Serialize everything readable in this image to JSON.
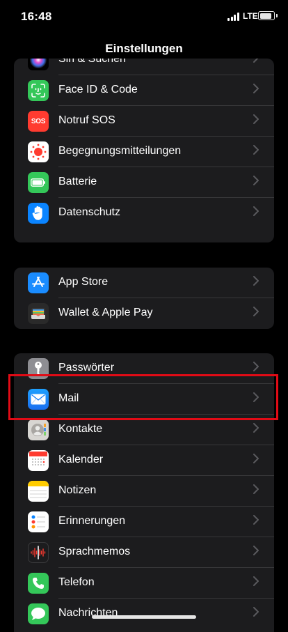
{
  "status": {
    "time": "16:48",
    "network": "LTE"
  },
  "nav": {
    "title": "Einstellungen"
  },
  "group1": [
    {
      "label": "Siri & Suchen",
      "icon": "siri-icon"
    },
    {
      "label": "Face ID & Code",
      "icon": "face-id-icon"
    },
    {
      "label": "Notruf SOS",
      "icon": "sos-icon",
      "icon_text": "SOS"
    },
    {
      "label": "Begegnungsmitteilungen",
      "icon": "exposure-notification-icon"
    },
    {
      "label": "Batterie",
      "icon": "battery-icon"
    },
    {
      "label": "Datenschutz",
      "icon": "privacy-hand-icon"
    }
  ],
  "group2": [
    {
      "label": "App Store",
      "icon": "app-store-icon"
    },
    {
      "label": "Wallet & Apple Pay",
      "icon": "wallet-icon"
    }
  ],
  "group3": [
    {
      "label": "Passwörter",
      "icon": "key-icon"
    },
    {
      "label": "Mail",
      "icon": "mail-icon"
    },
    {
      "label": "Kontakte",
      "icon": "contacts-icon"
    },
    {
      "label": "Kalender",
      "icon": "calendar-icon"
    },
    {
      "label": "Notizen",
      "icon": "notes-icon"
    },
    {
      "label": "Erinnerungen",
      "icon": "reminders-icon"
    },
    {
      "label": "Sprachmemos",
      "icon": "voice-memos-icon"
    },
    {
      "label": "Telefon",
      "icon": "phone-icon"
    },
    {
      "label": "Nachrichten",
      "icon": "messages-icon"
    }
  ],
  "colors": {
    "highlight": "#e10b16",
    "group_bg": "#1c1c1e",
    "separator": "#38383a",
    "chevron": "#5a5a5e"
  }
}
